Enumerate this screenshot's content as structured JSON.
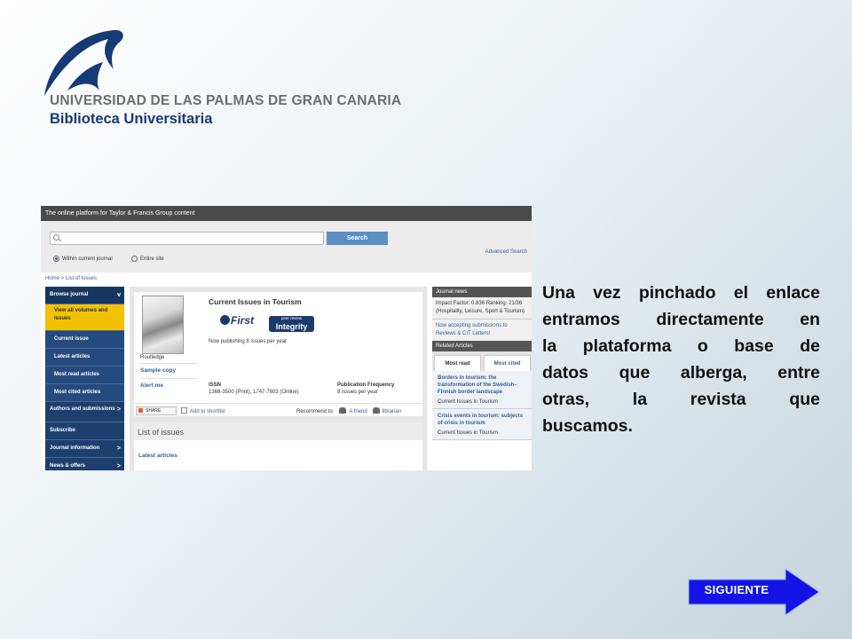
{
  "header": {
    "university": "UNIVERSIDAD DE LAS PALMAS DE GRAN CANARIA",
    "library": "Biblioteca Universitaria",
    "logo_icon": "ulpgc-logo-icon"
  },
  "screenshot": {
    "topbar": "The online platform for Taylor & Francis Group content",
    "search": {
      "placeholder": "",
      "button": "Search",
      "scope_options": [
        "Within current journal",
        "Entire site"
      ],
      "scope_selected": "Within current journal",
      "advanced": "Advanced Search"
    },
    "breadcrumb": {
      "home": "Home",
      "sep": " > ",
      "current": "List of Issues"
    },
    "nav": {
      "browse": "Browse journal",
      "view_all": "View all volumes and issues",
      "current_issue": "Current issue",
      "latest_articles": "Latest articles",
      "most_read": "Most read articles",
      "most_cited": "Most cited articles",
      "authors": "Authors and submissions",
      "subscribe": "Subscribe",
      "journal_info": "Journal information",
      "news": "News & offers",
      "chevron": "v",
      "arrow": ">"
    },
    "journal": {
      "title": "Current Issues in Tourism",
      "ifirst": "First",
      "integrity_small": "peer review",
      "integrity": "Integrity",
      "now_publishing": "Now publishing 8 issues per year",
      "publisher": "Routledge",
      "sample": "Sample copy",
      "alert": "Alert me",
      "issn_label": "ISSN",
      "issn_value": "1368-3500 (Print), 1747-7603 (Online)",
      "freq_label": "Publication Frequency",
      "freq_value": "8 issues per year",
      "share": "SHARE",
      "shortlist": "Add to shortlist",
      "recommend": "Recommend to:",
      "friend": "A friend",
      "librarian": "librarian"
    },
    "issues": {
      "header": "List of issues",
      "latest": "Latest articles"
    },
    "right": {
      "news_header": "Journal news",
      "impact": "Impact Factor: 0.836 Ranking: 21/36 (Hospitality, Leisure, Sport & Tourism)",
      "accepting": "Now accepting submissions to Reviews & CIT Letters!",
      "related_header": "Related Articles",
      "tab_read": "Most read",
      "tab_cited": "Most cited",
      "articles": [
        {
          "title": "Borders in tourism: the transformation of the Swedish–Finnish border landscape",
          "journal": "Current Issues in Tourism"
        },
        {
          "title": "Crisis events in tourism: subjects of crisis in tourism",
          "journal": "Current Issues in Tourism"
        }
      ]
    }
  },
  "description": {
    "lines": [
      "Una vez pinchado el enlace",
      "entramos directamente en",
      "la  plataforma o base de",
      "datos que alberga, entre",
      "otras, la revista que",
      "buscamos."
    ]
  },
  "next_button": {
    "label": "SIGUIENTE",
    "icon": "arrow-right-icon",
    "color": "#1414e6"
  },
  "colors": {
    "logo_blue": "#163a76",
    "nav_blue": "#1d3f6e",
    "nav_highlight": "#f2c200",
    "search_button": "#5b8fc6"
  }
}
